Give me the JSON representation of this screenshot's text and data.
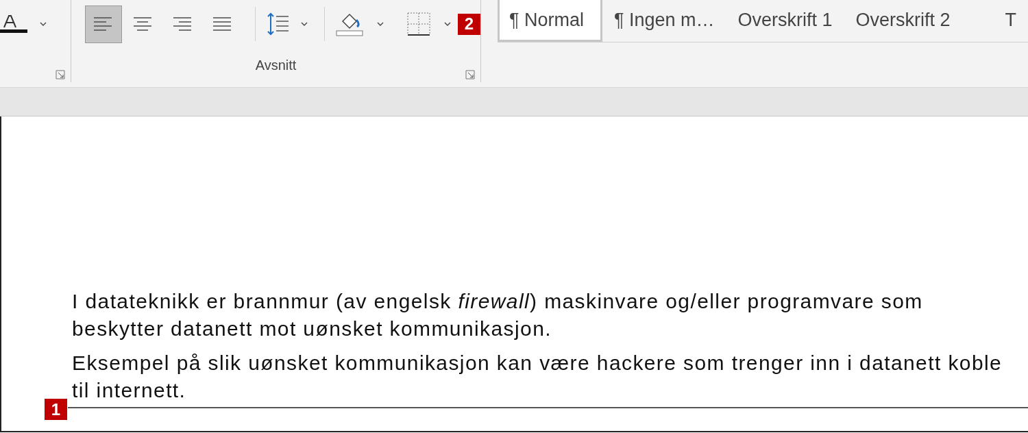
{
  "ribbon": {
    "paragraph_group": {
      "label": "Avsnitt",
      "align_buttons": [
        {
          "kind": "left",
          "selected": true
        },
        {
          "kind": "center",
          "selected": false
        },
        {
          "kind": "right",
          "selected": false
        },
        {
          "kind": "justify",
          "selected": false
        }
      ],
      "callout": "2"
    },
    "styles_group": {
      "styles": [
        {
          "label": "¶ Normal",
          "selected": true
        },
        {
          "label": "¶ Ingen m…",
          "selected": false
        },
        {
          "label": "Overskrift 1",
          "selected": false
        },
        {
          "label": "Overskrift 2",
          "selected": false
        },
        {
          "label": "T",
          "selected": false
        }
      ]
    }
  },
  "document": {
    "callout": "1",
    "paragraphs": [
      {
        "lines": [
          "I datateknikk er brannmur (av engelsk *firewall*) maskinvare og/eller programvare som",
          "beskytter datanett mot uønsket kommunikasjon."
        ]
      },
      {
        "lines": [
          "Eksempel på slik uønsket kommunikasjon kan være hackere som trenger inn i datanett koble",
          "til internett."
        ]
      }
    ]
  }
}
